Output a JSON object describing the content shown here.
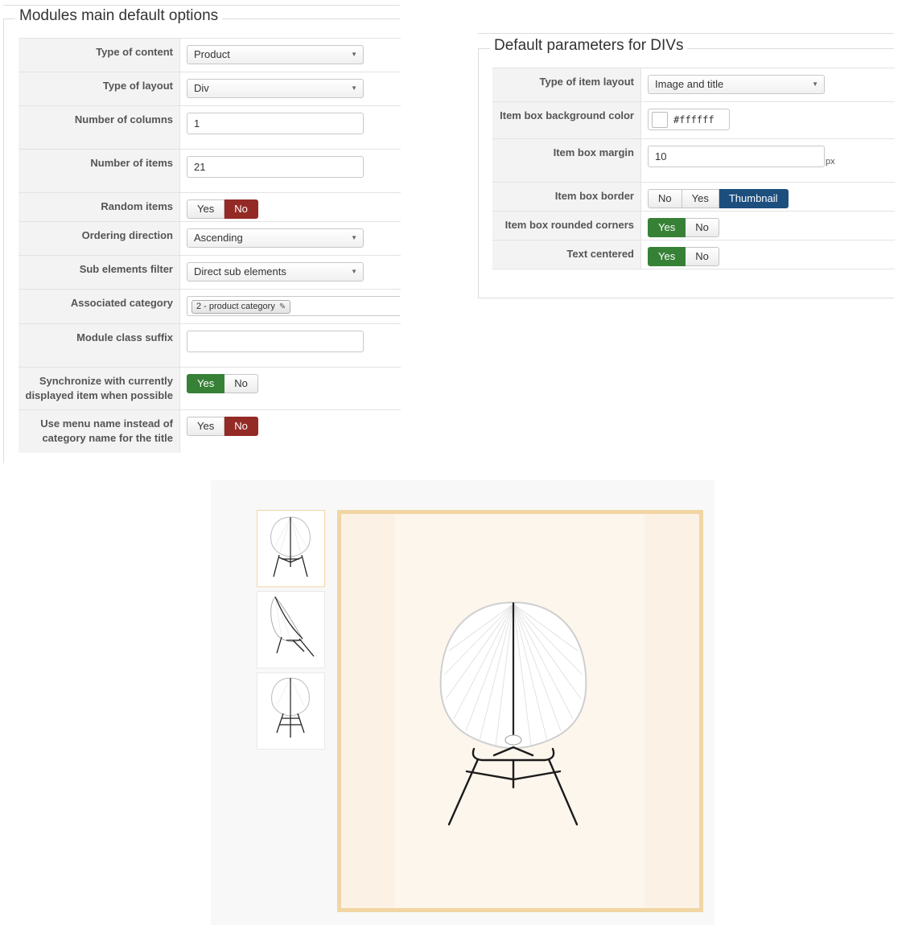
{
  "left_panel": {
    "legend": "Modules main default options",
    "rows": [
      {
        "label": "Type of content",
        "value": "Product"
      },
      {
        "label": "Type of layout",
        "value": "Div"
      },
      {
        "label": "Number of columns",
        "value": "1"
      },
      {
        "label": "Number of items",
        "value": "21"
      },
      {
        "label": "Random items",
        "yes": "Yes",
        "no": "No",
        "selected": "No"
      },
      {
        "label": "Ordering direction",
        "value": "Ascending"
      },
      {
        "label": "Sub elements filter",
        "value": "Direct sub elements"
      },
      {
        "label": "Associated category",
        "tag": "2 - product category"
      },
      {
        "label": "Module class suffix",
        "value": ""
      },
      {
        "label": "Synchronize with currently displayed item when possible",
        "yes": "Yes",
        "no": "No",
        "selected": "Yes"
      },
      {
        "label": "Use menu name instead of category name for the title",
        "yes": "Yes",
        "no": "No",
        "selected": "No"
      }
    ]
  },
  "right_panel": {
    "legend": "Default parameters for DIVs",
    "rows": [
      {
        "label": "Type of item layout",
        "value": "Image and title"
      },
      {
        "label": "Item box background color",
        "value": "#ffffff"
      },
      {
        "label": "Item box margin",
        "value": "10",
        "suffix": "px"
      },
      {
        "label": "Item box border",
        "options": [
          "No",
          "Yes",
          "Thumbnail"
        ],
        "selected": "Thumbnail"
      },
      {
        "label": "Item box rounded corners",
        "yes": "Yes",
        "no": "No",
        "selected": "Yes"
      },
      {
        "label": "Text centered",
        "yes": "Yes",
        "no": "No",
        "selected": "Yes"
      }
    ]
  },
  "gallery": {
    "thumbnails": [
      "chair-front",
      "chair-side",
      "chair-front-alt"
    ],
    "main_image": "chair-front"
  },
  "colors": {
    "no_red": "#942a25",
    "yes_green": "#378137",
    "thumbnail_blue": "#1d4f7e",
    "frame_gold": "#f1d6a4"
  }
}
